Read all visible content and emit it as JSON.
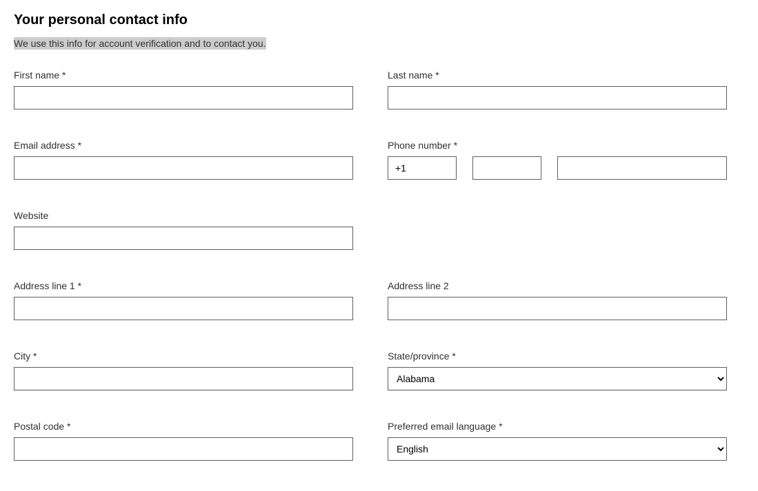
{
  "header": {
    "title": "Your personal contact info",
    "subtitle": "We use this info for account verification and to contact you."
  },
  "fields": {
    "first_name": {
      "label": "First name *",
      "value": ""
    },
    "last_name": {
      "label": "Last name *",
      "value": ""
    },
    "email": {
      "label": "Email address *",
      "value": ""
    },
    "phone": {
      "label": "Phone number *",
      "country_code": "+1",
      "area": "",
      "number": ""
    },
    "website": {
      "label": "Website",
      "value": ""
    },
    "address1": {
      "label": "Address line 1 *",
      "value": ""
    },
    "address2": {
      "label": "Address line 2",
      "value": ""
    },
    "city": {
      "label": "City *",
      "value": ""
    },
    "state": {
      "label": "State/province *",
      "selected": "Alabama"
    },
    "postal": {
      "label": "Postal code *",
      "value": ""
    },
    "language": {
      "label": "Preferred email language *",
      "selected": "English"
    }
  }
}
